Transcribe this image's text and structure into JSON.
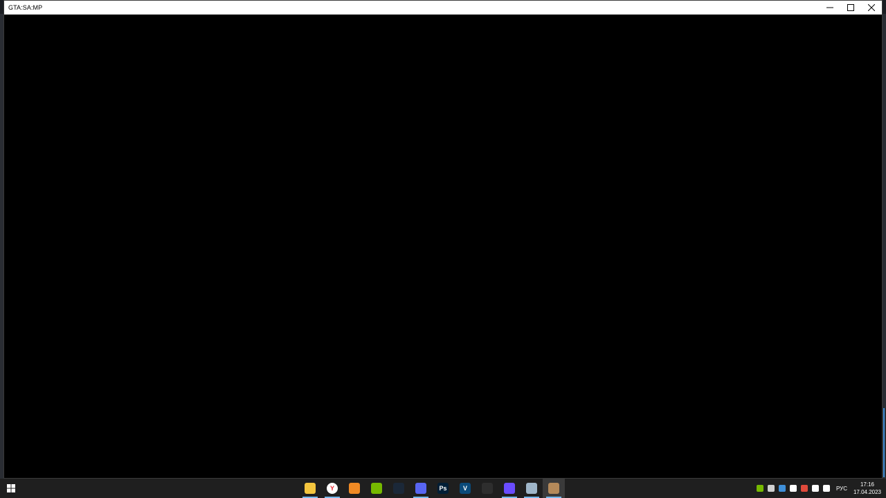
{
  "window": {
    "title": "GTA:SA:MP"
  },
  "taskbar": {
    "apps": [
      {
        "name": "File Explorer",
        "icon": "folder-icon",
        "color": "#f4c53e",
        "glyph": "",
        "active": true,
        "focused": false
      },
      {
        "name": "Yandex Browser",
        "icon": "yandex-icon",
        "color": "#ffffff",
        "glyph": "Y",
        "active": true,
        "focused": false
      },
      {
        "name": "FL Studio",
        "icon": "fl-studio-icon",
        "color": "#f08a24",
        "glyph": "",
        "active": false,
        "focused": false
      },
      {
        "name": "NVIDIA",
        "icon": "nvidia-icon",
        "color": "#76b900",
        "glyph": "",
        "active": false,
        "focused": false
      },
      {
        "name": "Steam",
        "icon": "steam-icon",
        "color": "#1b2838",
        "glyph": "",
        "active": false,
        "focused": false
      },
      {
        "name": "Discord",
        "icon": "discord-icon",
        "color": "#5865f2",
        "glyph": "",
        "active": true,
        "focused": false
      },
      {
        "name": "Photoshop",
        "icon": "photoshop-icon",
        "color": "#001e36",
        "glyph": "Ps",
        "active": false,
        "focused": false
      },
      {
        "name": "Vegas",
        "icon": "vegas-icon",
        "color": "#0a4a7a",
        "glyph": "V",
        "active": false,
        "focused": false
      },
      {
        "name": "Mouse Utility",
        "icon": "mouse-icon",
        "color": "#2e2e2e",
        "glyph": "",
        "active": false,
        "focused": false
      },
      {
        "name": "Launcher",
        "icon": "home-icon",
        "color": "#6a4cff",
        "glyph": "",
        "active": true,
        "focused": false
      },
      {
        "name": "Notes",
        "icon": "notes-icon",
        "color": "#9fb6c9",
        "glyph": "",
        "active": true,
        "focused": false
      },
      {
        "name": "GTA San Andreas",
        "icon": "gta-sa-icon",
        "color": "#b58a5a",
        "glyph": "",
        "active": true,
        "focused": true
      }
    ],
    "tray": [
      {
        "icon": "nvidia-tray-icon",
        "color": "#76b900"
      },
      {
        "icon": "gamepad-tray-icon",
        "color": "#d0d0d0"
      },
      {
        "icon": "memory-card-tray-icon",
        "color": "#3f8fd8"
      },
      {
        "icon": "microphone-tray-icon",
        "color": "#ffffff"
      },
      {
        "icon": "windows-security-tray-icon",
        "color": "#e04a3b"
      },
      {
        "icon": "network-tray-icon",
        "color": "#ffffff"
      },
      {
        "icon": "volume-tray-icon",
        "color": "#ffffff"
      }
    ],
    "language": "РУС",
    "time": "17:16",
    "date": "17.04.2023"
  }
}
